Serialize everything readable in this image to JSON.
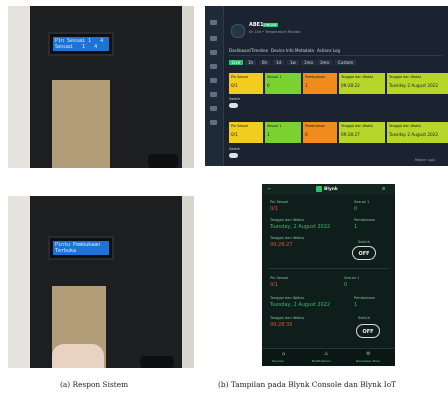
{
  "photo_top": {
    "lcd_line1": "Pin Sesuai 1   4",
    "lcd_line2": "Sesuai   1   4"
  },
  "photo_bottom": {
    "lcd_line1": "Pintu Pembukaan",
    "lcd_line2": "Terbuka"
  },
  "console": {
    "device_name": "ABE1",
    "device_badge": "ONLINE",
    "device_meta": "Kh 10d • Temperature Monitor",
    "tabs": [
      "Dashboard",
      "Timeline",
      "Device Info",
      "Metadata",
      "Actions Log"
    ],
    "filters": [
      "Live",
      "1h",
      "6h",
      "1d",
      "1w",
      "1mo",
      "3mo",
      "Custom"
    ],
    "row1": [
      {
        "label": "Pin Sesuai",
        "value": "0/1"
      },
      {
        "label": "Sesuai 1",
        "value": "0"
      },
      {
        "label": "Pembukaan",
        "value": "1"
      },
      {
        "label": "Tanggal dan Waktu",
        "value": "09:28:22"
      },
      {
        "label": "Tanggal dan Waktu",
        "value": "Tuesday 2 August 2022"
      }
    ],
    "row2": [
      {
        "label": "Pin Sesuai",
        "value": "0/1"
      },
      {
        "label": "Sesuai 1",
        "value": "1"
      },
      {
        "label": "Pembukaan",
        "value": "0"
      },
      {
        "label": "Tanggal dan Waktu",
        "value": "09:28:27"
      },
      {
        "label": "Tanggal dan Waktu",
        "value": "Tuesday 2 August 2022"
      }
    ],
    "switch_label": "Switch",
    "footer": "Region: sgp1"
  },
  "phone": {
    "app_title": "Blynk",
    "block1": {
      "label_a": "Pin Sesuai",
      "value_a": "0/1",
      "label_b": "Sesuai 1",
      "value_b": "0",
      "label_date": "Tanggal dan Waktu",
      "value_date": "Tuesday, 2 August 2022",
      "label_c": "Pembukaan",
      "value_c": "1",
      "label_time": "Tanggal dan Waktu",
      "value_time": "09:28:27",
      "switch_label": "Switch",
      "button": "OFF"
    },
    "block2": {
      "label_a": "Pin Sesuai",
      "value_a": "0/1",
      "label_b": "Sesuai 1",
      "value_b": "0",
      "label_date": "Tanggal dan Waktu",
      "value_date": "Tuesday, 2 August 2022",
      "label_c": "Pembukaan",
      "value_c": "1",
      "label_time": "Tanggal dan Waktu",
      "value_time": "09:28:35",
      "switch_label": "Switch",
      "button": "OFF"
    },
    "nav": [
      "Devices",
      "Notifications",
      "Developer Zone"
    ]
  },
  "captions": {
    "left": "(a) Respon Sistem",
    "right": "(b) Tampilan pada Blynk Console dan Blynk IoT"
  },
  "colors": {
    "tile_yellow": "#f2cd1f",
    "tile_green": "#7bd12f",
    "tile_orange": "#f08c1e",
    "tile_lime": "#b8d62a",
    "blynk_green": "#2fbf71"
  }
}
